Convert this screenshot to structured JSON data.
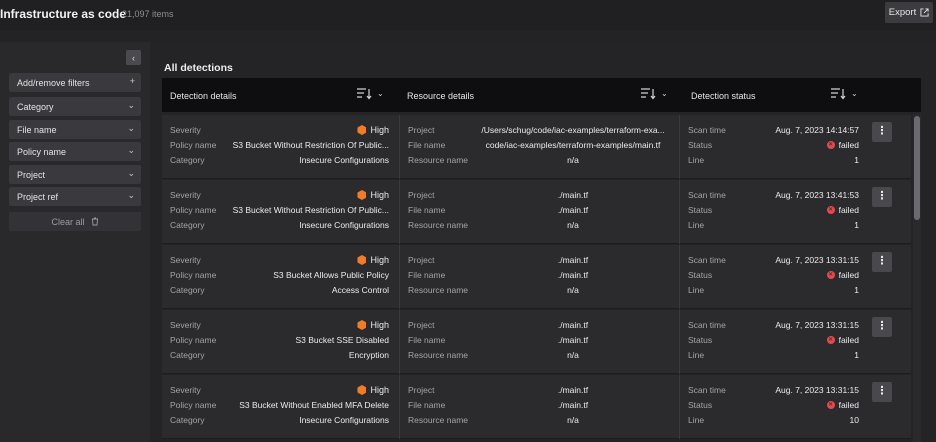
{
  "header": {
    "title": "Infrastructure as code",
    "count": "21,097 items",
    "export_label": "Export"
  },
  "sidebar": {
    "add_filter": "Add/remove filters",
    "filters": [
      "Category",
      "File name",
      "Policy name",
      "Project",
      "Project ref"
    ],
    "clear_all": "Clear all"
  },
  "main": {
    "title": "All detections",
    "columns": [
      "Detection details",
      "Resource details",
      "Detection status"
    ],
    "labels": {
      "severity": "Severity",
      "policy_name": "Policy name",
      "category": "Category",
      "project": "Project",
      "file_name": "File name",
      "resource_name": "Resource name",
      "scan_time": "Scan time",
      "status": "Status",
      "line": "Line"
    },
    "rows": [
      {
        "severity": "High",
        "policy": "S3 Bucket Without Restriction Of Public...",
        "category": "Insecure Configurations",
        "project": "/Users/schug/code/iac-examples/terraform-exa...",
        "file": "code/iac-examples/terraform-examples/main.tf",
        "resource": "n/a",
        "scan_time": "Aug. 7, 2023 14:14:57",
        "status": "failed",
        "line": "1"
      },
      {
        "severity": "High",
        "policy": "S3 Bucket Without Restriction Of Public...",
        "category": "Insecure Configurations",
        "project": "./main.tf",
        "file": "./main.tf",
        "resource": "n/a",
        "scan_time": "Aug. 7, 2023 13:41:53",
        "status": "failed",
        "line": "1"
      },
      {
        "severity": "High",
        "policy": "S3 Bucket Allows Public Policy",
        "category": "Access Control",
        "project": "./main.tf",
        "file": "./main.tf",
        "resource": "n/a",
        "scan_time": "Aug. 7, 2023 13:31:15",
        "status": "failed",
        "line": "1"
      },
      {
        "severity": "High",
        "policy": "S3 Bucket SSE Disabled",
        "category": "Encryption",
        "project": "./main.tf",
        "file": "./main.tf",
        "resource": "n/a",
        "scan_time": "Aug. 7, 2023 13:31:15",
        "status": "failed",
        "line": "1"
      },
      {
        "severity": "High",
        "policy": "S3 Bucket Without Enabled MFA Delete",
        "category": "Insecure Configurations",
        "project": "./main.tf",
        "file": "./main.tf",
        "resource": "n/a",
        "scan_time": "Aug. 7, 2023 13:31:15",
        "status": "failed",
        "line": "10"
      }
    ]
  },
  "icons": {
    "export": "external-link-icon",
    "collapse": "chevron-left-icon",
    "add": "plus-icon",
    "filter_dropdown": "chevron-down-icon",
    "clear": "trash-icon",
    "sort": "sort-descending-icon",
    "severity": "hexagon-icon",
    "status": "x-circle-icon",
    "row_menu": "kebab-menu-icon"
  },
  "colors": {
    "severity_high": "#f07c2a",
    "status_failed": "#e5484d"
  }
}
